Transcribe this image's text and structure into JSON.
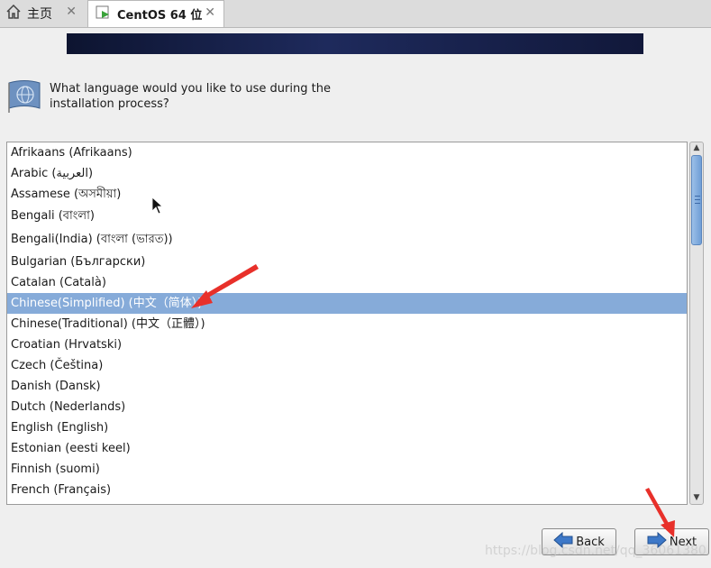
{
  "tabs": [
    {
      "label": "主页",
      "icon": "home-icon",
      "close": "✕"
    },
    {
      "label": "CentOS 64 位",
      "icon": "vm-icon",
      "close": "✕"
    }
  ],
  "prompt": {
    "line1": "What language would you like to use during the",
    "line2": "installation process?"
  },
  "languages": [
    "Afrikaans (Afrikaans)",
    "Arabic (العربية)",
    "Assamese (অসমীয়া)",
    "Bengali (বাংলা)",
    "Bengali(India) (বাংলা (ভারত))",
    "Bulgarian (Български)",
    "Catalan (Català)",
    "Chinese(Simplified) (中文（简体）)",
    "Chinese(Traditional) (中文（正體）)",
    "Croatian (Hrvatski)",
    "Czech (Čeština)",
    "Danish (Dansk)",
    "Dutch (Nederlands)",
    "English (English)",
    "Estonian (eesti keel)",
    "Finnish (suomi)",
    "French (Français)"
  ],
  "selected_language": "Chinese(Simplified) (中文（简体）)",
  "buttons": {
    "back": "Back",
    "next": "Next"
  },
  "watermark": "https://blog.csdn.net/qq_36061380",
  "colors": {
    "selection": "#86abd9",
    "annotation_arrow": "#e8302a",
    "banner": "#101838"
  }
}
